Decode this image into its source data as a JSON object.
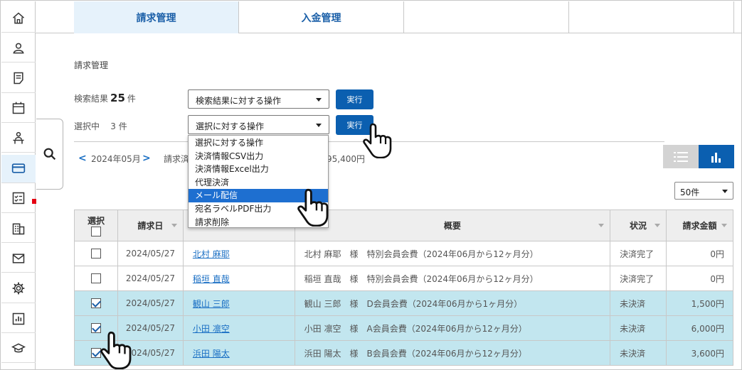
{
  "sidebar": {
    "items": [
      {
        "icon": "home-icon"
      },
      {
        "icon": "user-icon"
      },
      {
        "icon": "document-icon"
      },
      {
        "icon": "calendar-icon"
      },
      {
        "icon": "person-desk-icon"
      },
      {
        "icon": "credit-card-icon",
        "active": true
      },
      {
        "icon": "checklist-icon"
      },
      {
        "icon": "building-icon"
      },
      {
        "icon": "mail-icon"
      },
      {
        "icon": "gear-icon"
      },
      {
        "icon": "bar-chart-icon"
      },
      {
        "icon": "graduation-cap-icon"
      }
    ]
  },
  "tabs": [
    {
      "label": "請求管理",
      "active": true
    },
    {
      "label": "入金管理",
      "active": false
    },
    {
      "label": ""
    },
    {
      "label": ""
    },
    {
      "label": ""
    }
  ],
  "page": {
    "title": "請求管理",
    "search_result_label": "検索結果",
    "search_result_count": "25",
    "search_result_unit": "件",
    "selected_label": "選択中",
    "selected_count": "3 件",
    "result_action_select": "検索結果に対する操作",
    "selection_action_select": "選択に対する操作",
    "exec_label": "実行"
  },
  "month_nav": {
    "prev": "<",
    "month": "2024年05月",
    "next": ">",
    "summary_a": "請求済",
    "summary_b": "95,400円"
  },
  "per_page": "50件",
  "dropdown": {
    "items": [
      {
        "label": "選択に対する操作"
      },
      {
        "label": "決済情報CSV出力"
      },
      {
        "label": "決済情報Excel出力"
      },
      {
        "label": "代理決済"
      },
      {
        "label": "メール配信",
        "highlighted": true
      },
      {
        "label": "宛名ラベルPDF出力"
      },
      {
        "label": "請求削除"
      }
    ]
  },
  "table": {
    "headers": {
      "select": "選択",
      "date": "請求日",
      "name": "",
      "summary": "概要",
      "status": "状況",
      "amount": "請求金額"
    },
    "rows": [
      {
        "checked": false,
        "date": "2024/05/27",
        "name": "北村 麻耶",
        "summary": "北村 麻耶　様　特別会員会費（2024年06月から12ヶ月分）",
        "status": "決済完了",
        "amount": "0円"
      },
      {
        "checked": false,
        "date": "2024/05/27",
        "name": "稲垣 直哉",
        "summary": "稲垣 直哉　様　特別会員会費（2024年06月から12ヶ月分）",
        "status": "決済完了",
        "amount": "0円"
      },
      {
        "checked": true,
        "date": "2024/05/27",
        "name": "観山 三郎",
        "summary": "観山 三郎　様　D会員会費（2024年06月から1ヶ月分）",
        "status": "未決済",
        "amount": "1,500円"
      },
      {
        "checked": true,
        "date": "2024/05/27",
        "name": "小田 凛空",
        "summary": "小田 凛空　様　A会員会費（2024年06月から12ヶ月分）",
        "status": "未決済",
        "amount": "6,000円"
      },
      {
        "checked": true,
        "date": "2024/05/27",
        "name": "浜田 陽太",
        "summary": "浜田 陽太　様　B会員会費（2024年06月から12ヶ月分）",
        "status": "未決済",
        "amount": "3,600円"
      }
    ]
  },
  "colors": {
    "accent": "#0b5fb0",
    "link": "#1a6fc4",
    "row_selected": "#c2e6ef",
    "menu_highlight": "#1e6fd0",
    "badge_red": "#e50012"
  }
}
